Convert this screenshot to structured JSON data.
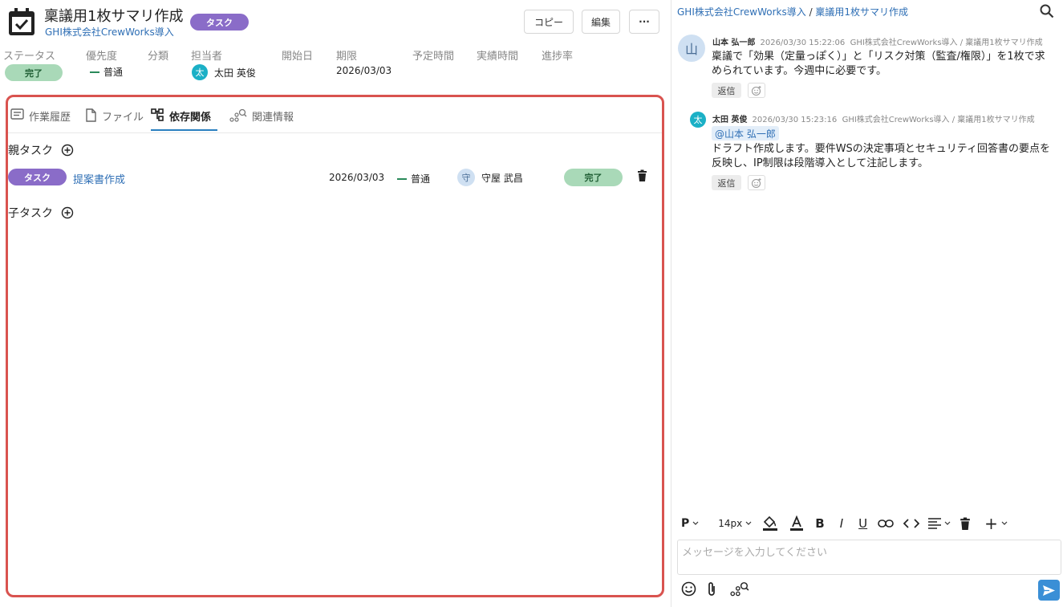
{
  "header": {
    "title": "稟議用1枚サマリ作成",
    "project": "GHI株式会社CrewWorks導入",
    "type_badge": "タスク",
    "copy_label": "コピー",
    "edit_label": "編集",
    "more_label": "···"
  },
  "meta": {
    "labels": {
      "status": "ステータス",
      "priority": "優先度",
      "category": "分類",
      "assignee": "担当者",
      "start": "開始日",
      "due": "期限",
      "planned": "予定時間",
      "actual": "実績時間",
      "progress": "進捗率"
    },
    "values": {
      "status": "完了",
      "priority": "普通",
      "assignee_initial": "太",
      "assignee": "太田 英俊",
      "due": "2026/03/03"
    }
  },
  "tabs": [
    {
      "label": "作業履歴",
      "icon": "history-icon"
    },
    {
      "label": "ファイル",
      "icon": "file-icon"
    },
    {
      "label": "依存関係",
      "icon": "dependency-icon",
      "active": true
    },
    {
      "label": "関連情報",
      "icon": "related-icon"
    }
  ],
  "dependencies": {
    "parent_label": "親タスク",
    "child_label": "子タスク",
    "parent_row": {
      "type": "タスク",
      "name": "提案書作成",
      "due": "2026/03/03",
      "priority": "普通",
      "assignee_initial": "守",
      "assignee": "守屋 武昌",
      "status": "完了"
    }
  },
  "chat": {
    "breadcrumb_project": "GHI株式会社CrewWorks導入",
    "breadcrumb_sep": " / ",
    "breadcrumb_task": "稟議用1枚サマリ作成",
    "messages": [
      {
        "avatar": "山",
        "author": "山本 弘一郎",
        "timestamp": "2026/03/30 15:22:06",
        "context": "GHI株式会社CrewWorks導入 / 稟議用1枚サマリ作成",
        "line1": "稟議で「効果（定量っぽく）」と「リスク対策（監査/権限）」を1枚で求",
        "line2": "められています。今週中に必要です。",
        "reply": "返信"
      },
      {
        "avatar": "太",
        "author": "太田 英俊",
        "timestamp": "2026/03/30 15:23:16",
        "context": "GHI株式会社CrewWorks導入 / 稟議用1枚サマリ作成",
        "mention": "@山本 弘一郎",
        "line1": "ドラフト作成します。要件WSの決定事項とセキュリティ回答書の要点を",
        "line2": "反映し、IP制限は段階導入として注記します。",
        "reply": "返信"
      }
    ],
    "toolbar": {
      "paragraph": "P",
      "font_size": "14px",
      "bold": "B",
      "italic": "I",
      "underline": "U",
      "insert": "+"
    },
    "compose_placeholder": "メッセージを入力してください"
  },
  "colors": {
    "accent": "#2f6fb5",
    "task_badge": "#8a6cc8",
    "done_status": "#a9d9b8",
    "highlight_border": "#d9534f",
    "send_button": "#3a8fd6"
  }
}
